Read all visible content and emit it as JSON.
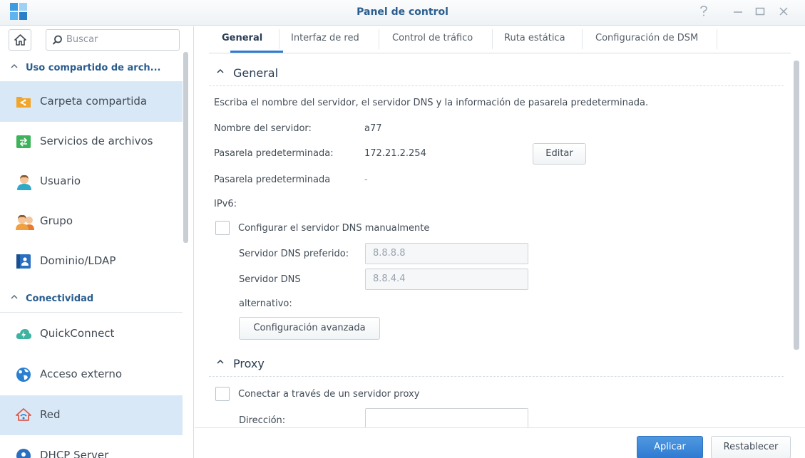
{
  "window": {
    "title": "Panel de control",
    "controls": [
      "help-icon",
      "minimize-icon",
      "maximize-icon",
      "close-icon"
    ]
  },
  "sidebar": {
    "search_placeholder": "Buscar",
    "sections": [
      {
        "label": "Uso compartido de arch...",
        "items": [
          {
            "label": "Carpeta compartida",
            "icon": "folder-share-icon",
            "selected": true
          },
          {
            "label": "Servicios de archivos",
            "icon": "file-services-icon"
          },
          {
            "label": "Usuario",
            "icon": "user-icon"
          },
          {
            "label": "Grupo",
            "icon": "group-icon"
          },
          {
            "label": "Dominio/LDAP",
            "icon": "domain-icon"
          }
        ]
      },
      {
        "label": "Conectividad",
        "items": [
          {
            "label": "QuickConnect",
            "icon": "quickconnect-icon"
          },
          {
            "label": "Acceso externo",
            "icon": "globe-icon"
          },
          {
            "label": "Red",
            "icon": "network-house-icon",
            "selected": true
          },
          {
            "label": "DHCP Server",
            "icon": "dhcp-icon"
          }
        ]
      }
    ]
  },
  "tabs": [
    {
      "label": "General",
      "active": true
    },
    {
      "label": "Interfaz de red"
    },
    {
      "label": "Control de tráfico"
    },
    {
      "label": "Ruta estática"
    },
    {
      "label": "Configuración de DSM"
    }
  ],
  "general": {
    "heading": "General",
    "description": "Escriba el nombre del servidor, el servidor DNS y la información de pasarela predeterminada.",
    "server_name_label": "Nombre del servidor:",
    "server_name_value": "a77",
    "gateway_label": "Pasarela predeterminada:",
    "gateway_value": "172.21.2.254",
    "edit_button": "Editar",
    "gateway_v6_label": "Pasarela predeterminada",
    "gateway_v6_value": "-",
    "ipv6_label": "IPv6:",
    "manual_dns_label": "Configurar el servidor DNS manualmente",
    "manual_dns_checked": false,
    "preferred_dns_label": "Servidor DNS preferido:",
    "preferred_dns_value": "8.8.8.8",
    "alternate_dns_label_1": "Servidor DNS",
    "alternate_dns_label_2": "alternativo:",
    "alternate_dns_value": "8.8.4.4",
    "advanced_button": "Configuración avanzada"
  },
  "proxy": {
    "heading": "Proxy",
    "connect_label": "Conectar a través de un servidor proxy",
    "connect_checked": false,
    "address_label": "Dirección:",
    "address_value": ""
  },
  "footer": {
    "apply_button": "Aplicar",
    "reset_button": "Restablecer"
  },
  "colors": {
    "accent": "#2f7bd1",
    "title_text": "#2a5d8f",
    "selected_bg": "#d9e8f6"
  }
}
